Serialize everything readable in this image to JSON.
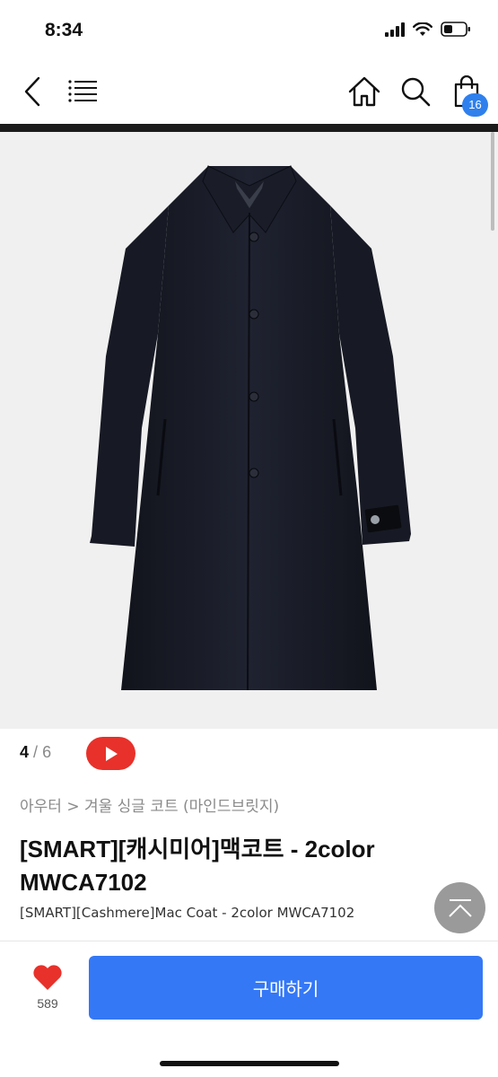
{
  "status_bar": {
    "time": "8:34"
  },
  "nav": {
    "icons": [
      "back-icon",
      "menu-icon",
      "home-icon",
      "search-icon",
      "cart-icon"
    ],
    "cart_count": "16"
  },
  "gallery": {
    "current": "4",
    "separator": "/",
    "total": "6"
  },
  "breadcrumb": "아우터 > 겨울 싱글 코트 (마인드브릿지)",
  "product": {
    "title_line1": "[SMART][캐시미어]맥코트 - 2color",
    "title_line2": "MWCA7102",
    "subtitle": "[SMART][Cashmere]Mac Coat - 2color MWCA7102"
  },
  "like": {
    "count": "589"
  },
  "buy_button": "구매하기",
  "colors": {
    "accent": "#3478f6",
    "youtube": "#e8312a",
    "heart": "#e8312a",
    "badge": "#2f80ed"
  }
}
